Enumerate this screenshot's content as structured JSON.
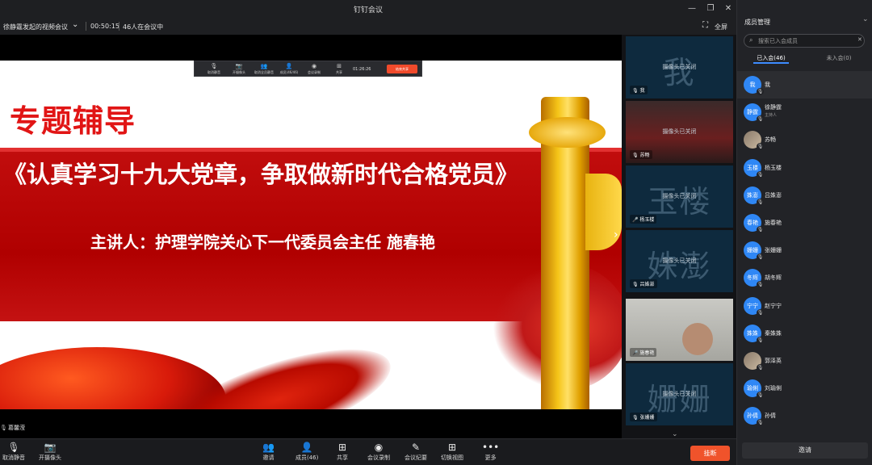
{
  "window": {
    "title": "钉钉会议",
    "minimize": "—",
    "restore": "❐",
    "close": "✕"
  },
  "info": {
    "meeting_name": "徐静霆发起的视频会议",
    "dropdown": "⌄",
    "duration": "00:50:15",
    "count_text": "46人在会议中",
    "fullscreen_icon": "⛶",
    "fullscreen": "全屏"
  },
  "slide": {
    "heading": "专题辅导",
    "course": "《认真学习十九大党章，争取做新时代合格党员》",
    "speaker": "主讲人：护理学院关心下一代委员会主任 施春艳"
  },
  "mini_toolbar": {
    "items": [
      "取消静音",
      "开摄像头",
      "取消全员静音",
      "成员(46/46)",
      "会议录制",
      "共享"
    ],
    "time": "01:26:26",
    "end": "结束共享"
  },
  "presenter": {
    "name": "葛馨滢"
  },
  "strip": {
    "camera_off": "摄像头已关闭",
    "tiles": [
      {
        "big": "我",
        "name": "我"
      },
      {
        "big": "",
        "name": "苏畅"
      },
      {
        "big": "玉楼",
        "name": "杨玉楼"
      },
      {
        "big": "姝澎",
        "name": "吕姝澎"
      },
      {
        "big": "",
        "name": "施春艳"
      },
      {
        "big": "姗姗",
        "name": "张姗姗"
      }
    ]
  },
  "toolbar": {
    "mute": "取消静音",
    "camera": "开摄像头",
    "invite": "邀请",
    "members": "成员(46)",
    "share": "共享",
    "record": "会议录制",
    "minutes": "会议纪要",
    "layout": "切换视图",
    "more": "更多",
    "hangup": "挂断"
  },
  "panel": {
    "title": "成员管理",
    "search_placeholder": "搜索已入会成员",
    "tab_joined": "已入会(46)",
    "tab_not_joined": "未入会(0)",
    "invite": "邀请",
    "members": [
      {
        "avatar": "我",
        "name": "我",
        "role": ""
      },
      {
        "avatar": "静霆",
        "name": "徐静霆",
        "role": "主持人"
      },
      {
        "avatar": "",
        "name": "苏畅",
        "role": ""
      },
      {
        "avatar": "玉楼",
        "name": "杨玉楼",
        "role": ""
      },
      {
        "avatar": "姝澎",
        "name": "吕姝澎",
        "role": ""
      },
      {
        "avatar": "春艳",
        "name": "施春艳",
        "role": ""
      },
      {
        "avatar": "姗姗",
        "name": "张姗姗",
        "role": ""
      },
      {
        "avatar": "冬辉",
        "name": "胡冬辉",
        "role": ""
      },
      {
        "avatar": "宁宁",
        "name": "赵宁宁",
        "role": ""
      },
      {
        "avatar": "姝姝",
        "name": "秦姝姝",
        "role": ""
      },
      {
        "avatar": "",
        "name": "郭泽英",
        "role": ""
      },
      {
        "avatar": "瑜俐",
        "name": "刘瑜俐",
        "role": ""
      },
      {
        "avatar": "孙倩",
        "name": "孙倩",
        "role": ""
      }
    ]
  }
}
